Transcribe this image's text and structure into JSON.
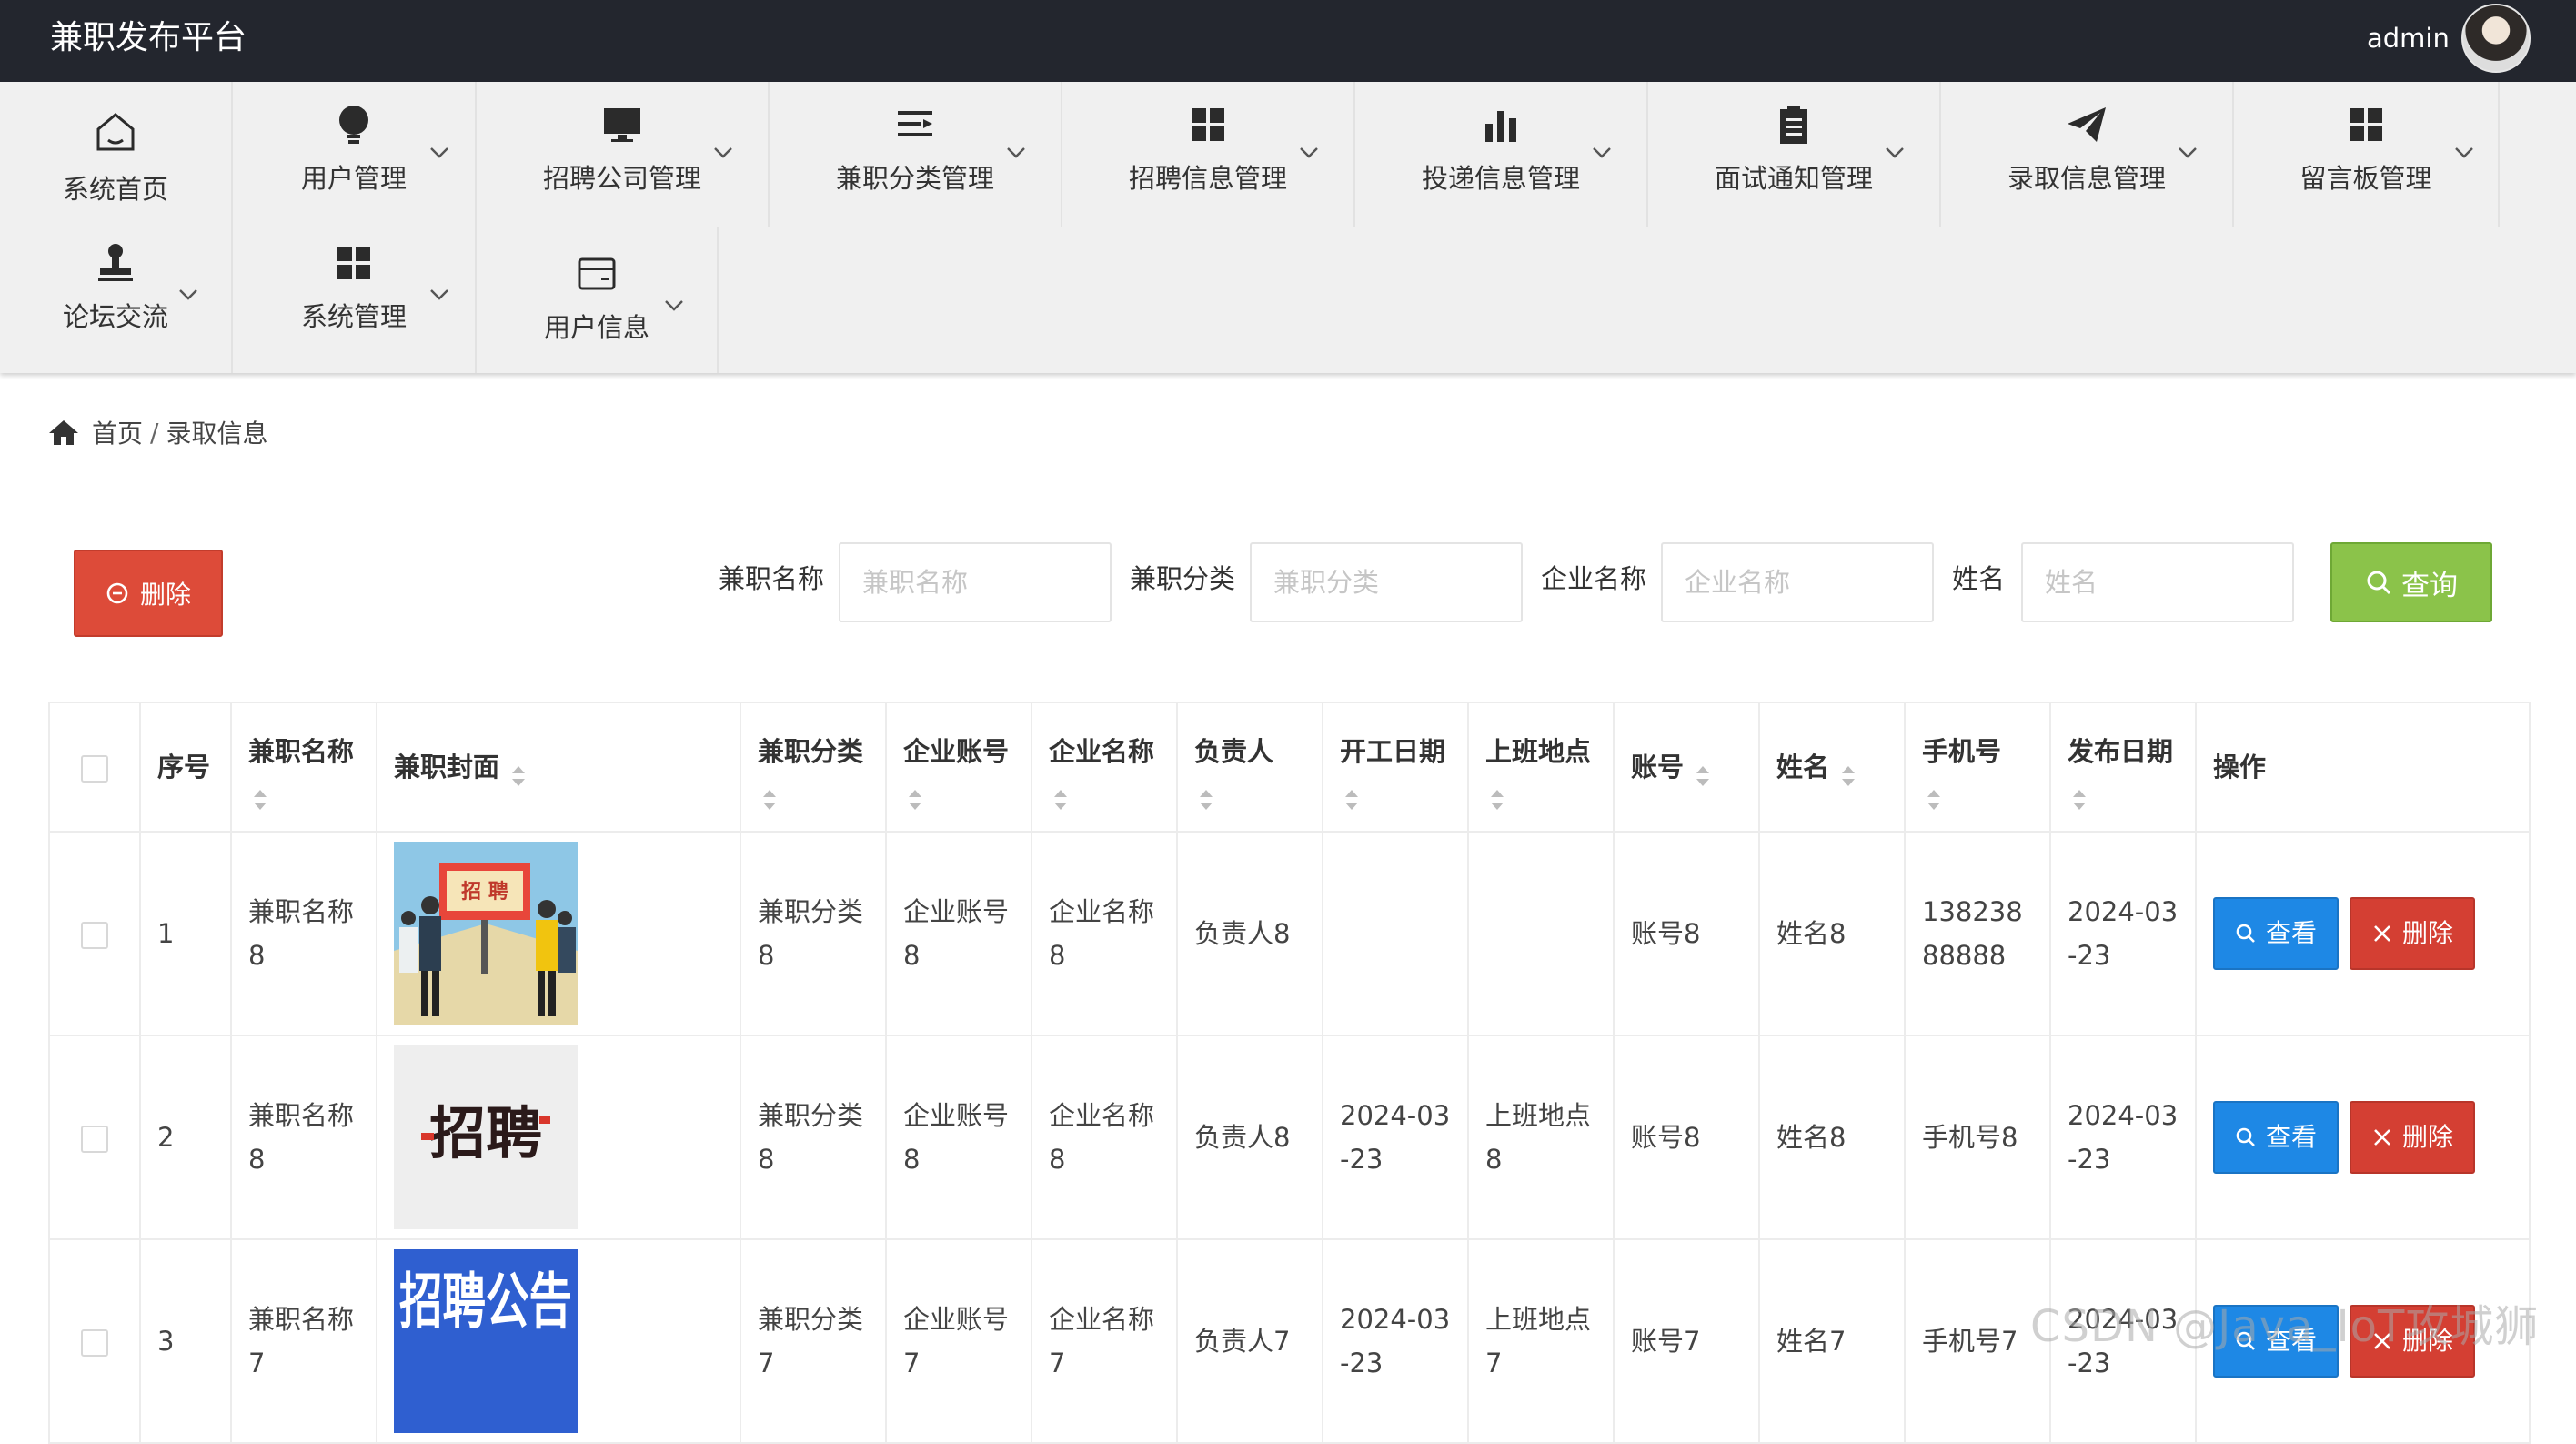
{
  "app": {
    "title": "兼职发布平台",
    "user": "admin"
  },
  "menu": [
    {
      "label": "系统首页",
      "icon": "home-icon"
    },
    {
      "label": "用户管理",
      "icon": "lightbulb-icon"
    },
    {
      "label": "招聘公司管理",
      "icon": "monitor-icon"
    },
    {
      "label": "兼职分类管理",
      "icon": "list-icon"
    },
    {
      "label": "招聘信息管理",
      "icon": "grid-icon"
    },
    {
      "label": "投递信息管理",
      "icon": "bar-chart-icon"
    },
    {
      "label": "面试通知管理",
      "icon": "clipboard-icon"
    },
    {
      "label": "录取信息管理",
      "icon": "paper-plane-icon"
    },
    {
      "label": "留言板管理",
      "icon": "grid-icon"
    },
    {
      "label": "论坛交流",
      "icon": "stamp-icon"
    },
    {
      "label": "系统管理",
      "icon": "grid-icon"
    },
    {
      "label": "用户信息",
      "icon": "card-icon"
    }
  ],
  "breadcrumb": {
    "home": "首页",
    "separator": "/",
    "current": "录取信息"
  },
  "toolbar": {
    "delete_label": "删除",
    "query_label": "查询",
    "filters": [
      {
        "label": "兼职名称",
        "placeholder": "兼职名称",
        "value": ""
      },
      {
        "label": "兼职分类",
        "placeholder": "兼职分类",
        "value": ""
      },
      {
        "label": "企业名称",
        "placeholder": "企业名称",
        "value": ""
      },
      {
        "label": "姓名",
        "placeholder": "姓名",
        "value": ""
      }
    ]
  },
  "table": {
    "headers": [
      "序号",
      "兼职名称",
      "兼职封面",
      "兼职分类",
      "企业账号",
      "企业名称",
      "负责人",
      "开工日期",
      "上班地点",
      "账号",
      "姓名",
      "手机号",
      "发布日期",
      "操作"
    ],
    "view_label": "查看",
    "delete_label": "删除",
    "rows": [
      {
        "index": "1",
        "name": "兼职名称8",
        "cover_text": "招 聘",
        "category": "兼职分类8",
        "account": "企业账号8",
        "company": "企业名称8",
        "manager": "负责人8",
        "start_date": "",
        "location": "",
        "user_account": "账号8",
        "person": "姓名8",
        "phone": "13823888888",
        "publish_date": "2024-03-23"
      },
      {
        "index": "2",
        "name": "兼职名称8",
        "cover_text": "招聘",
        "category": "兼职分类8",
        "account": "企业账号8",
        "company": "企业名称8",
        "manager": "负责人8",
        "start_date": "2024-03-23",
        "location": "上班地点8",
        "user_account": "账号8",
        "person": "姓名8",
        "phone": "手机号8",
        "publish_date": "2024-03-23"
      },
      {
        "index": "3",
        "name": "兼职名称7",
        "cover_text": "招聘公告",
        "category": "兼职分类7",
        "account": "企业账号7",
        "company": "企业名称7",
        "manager": "负责人7",
        "start_date": "2024-03-23",
        "location": "上班地点7",
        "user_account": "账号7",
        "person": "姓名7",
        "phone": "手机号7",
        "publish_date": "2024-03-23"
      }
    ]
  },
  "watermark": "CSDN @Java_IoT攻城狮",
  "colors": {
    "topbar": "#23262e",
    "menu_bg": "#f0f0f0",
    "danger": "#dd4b39",
    "query": "#8bc34a",
    "view": "#1e88e5"
  }
}
